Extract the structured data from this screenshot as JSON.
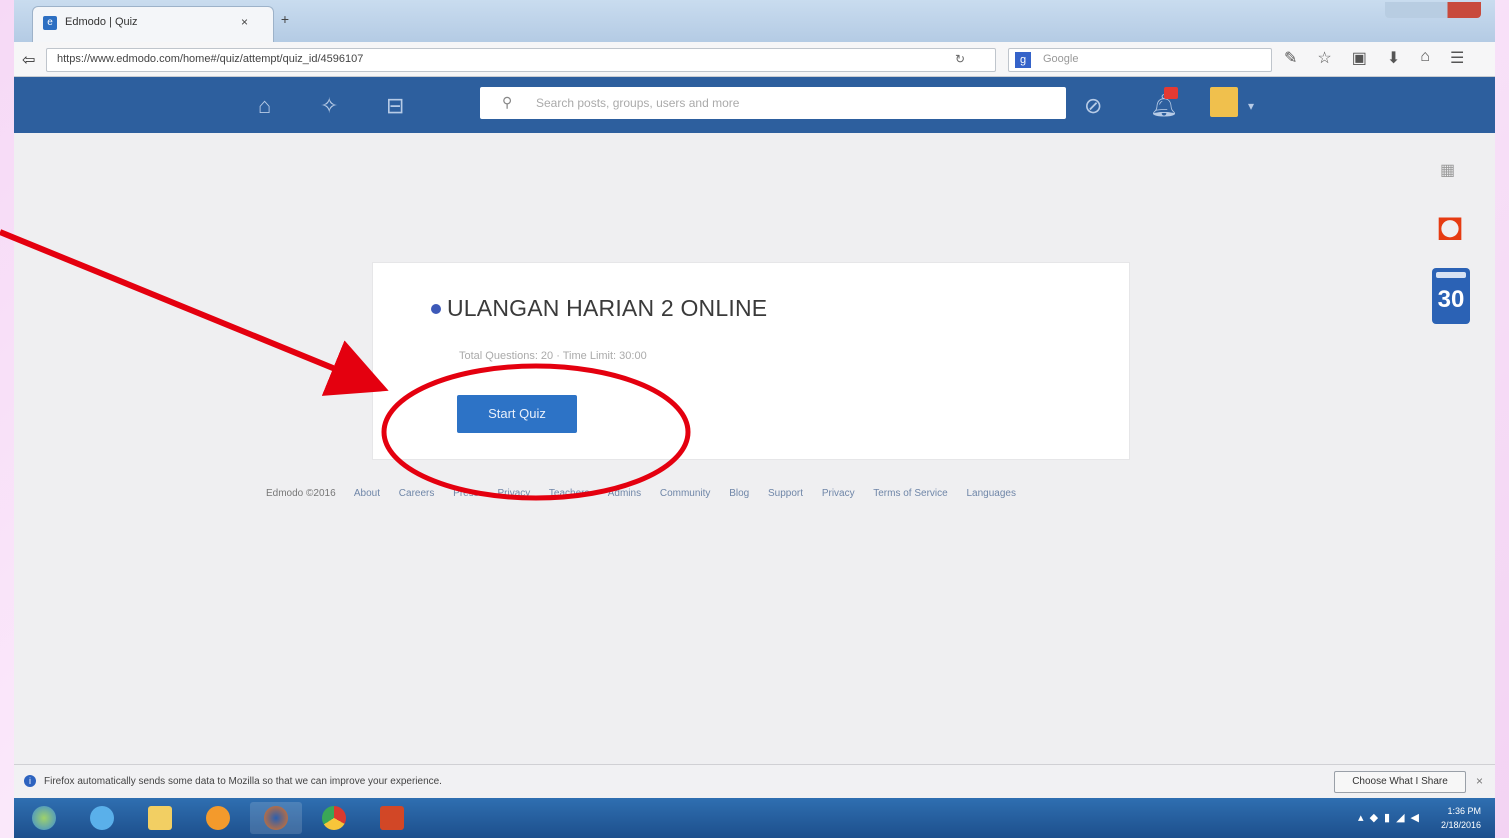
{
  "browser": {
    "tab_title": "Edmodo | Quiz",
    "tab_close": "×",
    "new_tab": "+",
    "url": "https://www.edmodo.com/home#/quiz/attempt/quiz_id/4596107",
    "search_placeholder": "Google"
  },
  "edmodo": {
    "search_placeholder": "Search posts, groups, users and more"
  },
  "quiz": {
    "title": "ULANGAN HARIAN 2 ONLINE",
    "meta": "Total Questions: 20  ·  Time Limit: 30:00",
    "start_label": "Start Quiz"
  },
  "footer": {
    "copyright": "Edmodo ©2016",
    "links": [
      "About",
      "Careers",
      "Press",
      "Privacy",
      "Teachers",
      "Admins",
      "Community",
      "Blog",
      "Support",
      "Privacy",
      "Terms of Service",
      "Languages"
    ]
  },
  "side_apps": {
    "calendar_day": "30"
  },
  "firefox_notice": {
    "message": "Firefox automatically sends some data to Mozilla so that we can improve your experience.",
    "choose_label": "Choose What I Share",
    "close": "×"
  },
  "taskbar": {
    "time": "1:36 PM",
    "date": "2/18/2016"
  },
  "colors": {
    "edmodo_blue": "#2d5f9e",
    "button_blue": "#2d73c6",
    "annotation_red": "#e4000f"
  }
}
